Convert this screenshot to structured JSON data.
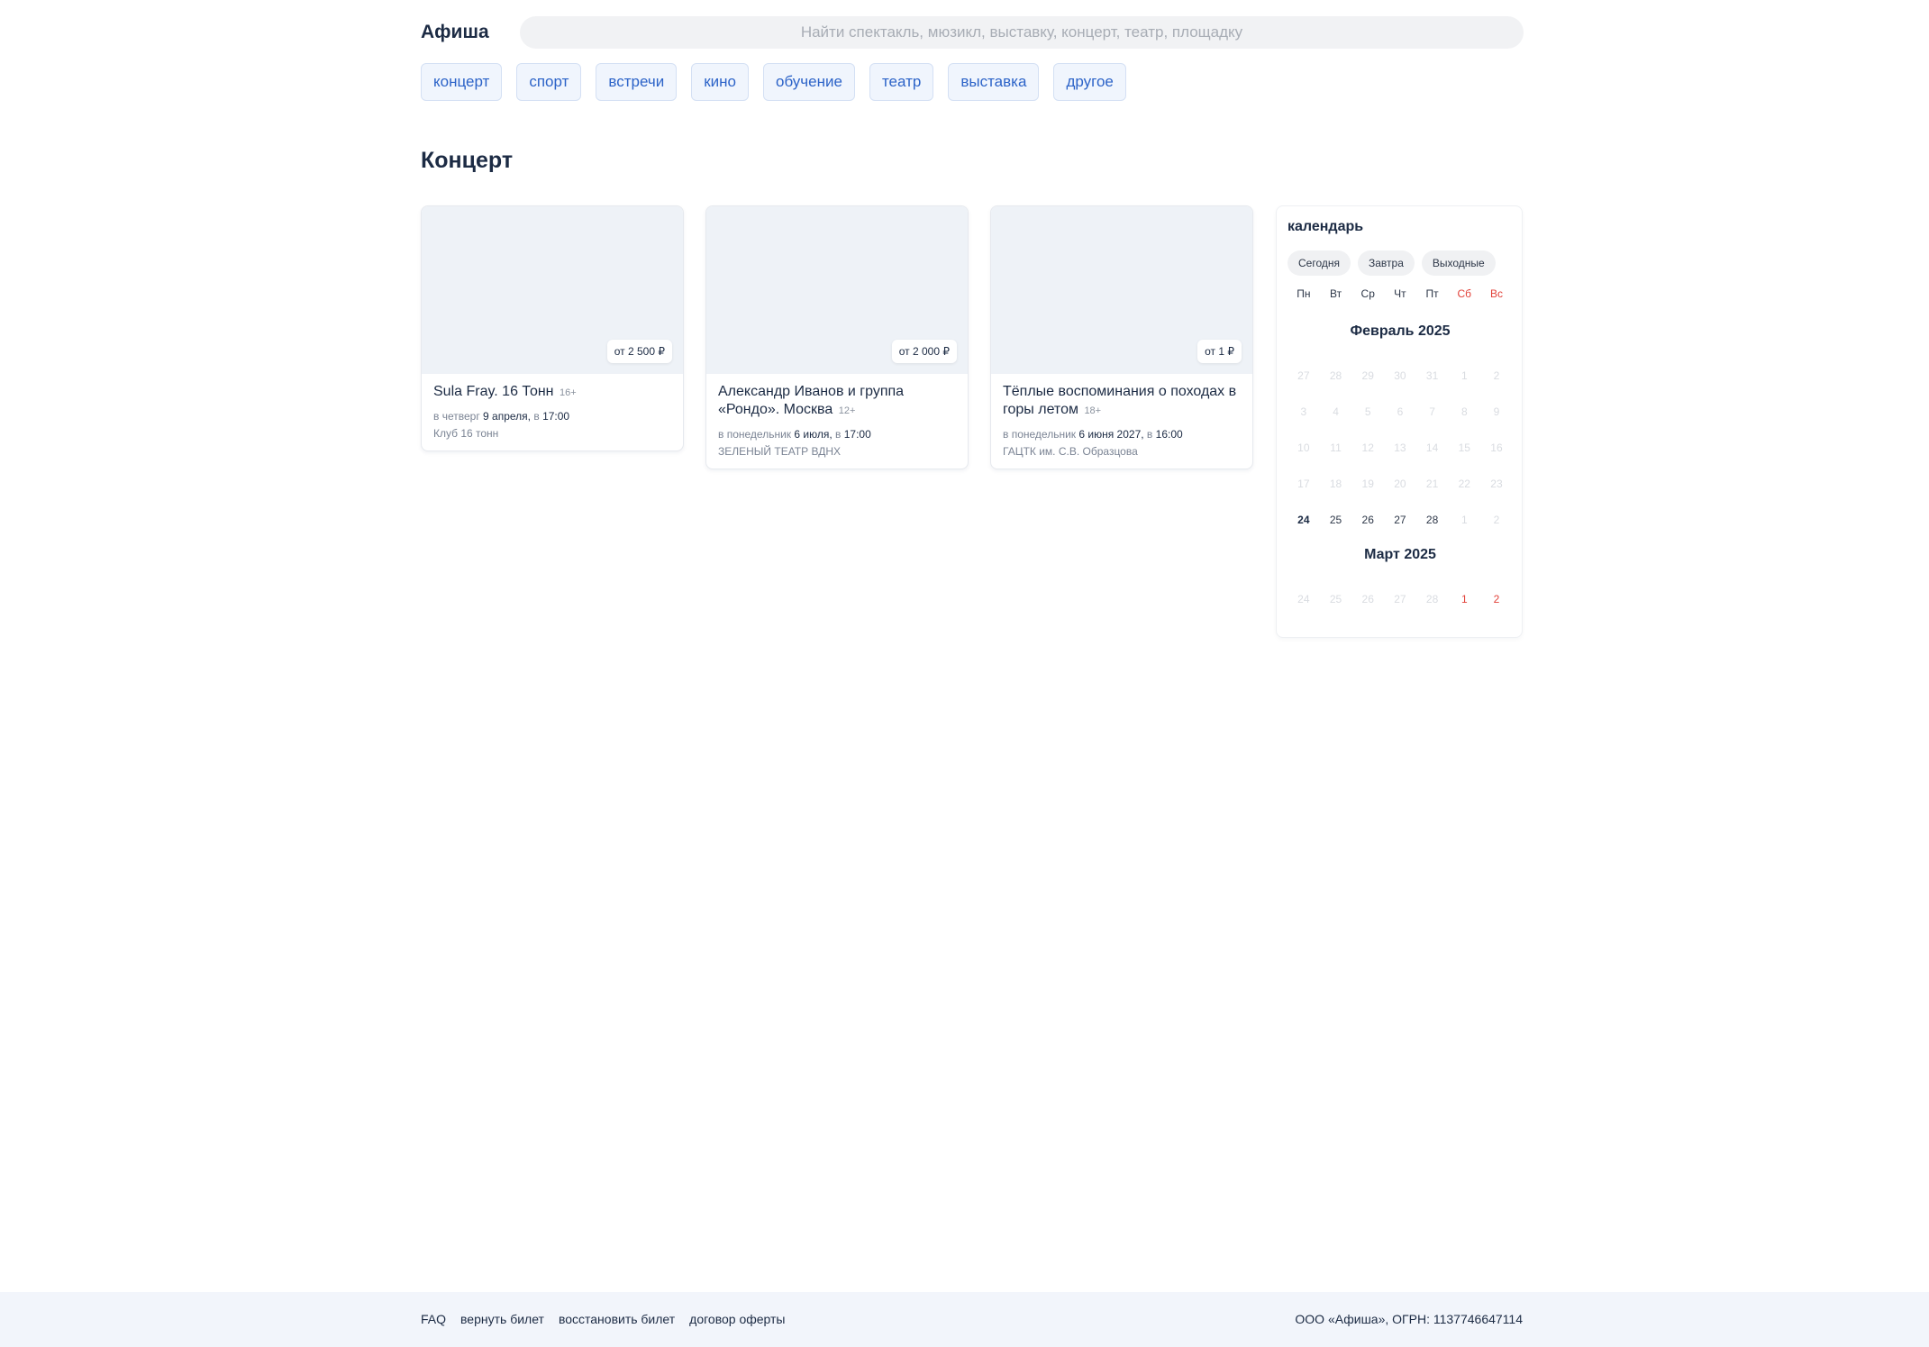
{
  "header": {
    "logo": "Афиша",
    "search_placeholder": "Найти спектакль, мюзикл, выставку, концерт, театр, площадку"
  },
  "categories": [
    "концерт",
    "спорт",
    "встречи",
    "кино",
    "обучение",
    "театр",
    "выставка",
    "другое"
  ],
  "section_title": "Концерт",
  "events": [
    {
      "title": "Sula Fray. 16 Тонн",
      "age": "16+",
      "price": "от 2 500 ₽",
      "when_prefix": "в четверг",
      "date": "9 апреля,",
      "time_prefix": "в",
      "time": "17:00",
      "place": "Клуб 16 тонн"
    },
    {
      "title": "Александр Иванов и группа «Рондо». Москва",
      "age": "12+",
      "price": "от 2 000 ₽",
      "when_prefix": "в понедельник",
      "date": "6 июля,",
      "time_prefix": "в",
      "time": "17:00",
      "place": "ЗЕЛЕНЫЙ ТЕАТР ВДНХ"
    },
    {
      "title": "Тёплые воспоминания о походах в горы летом",
      "age": "18+",
      "price": "от 1 ₽",
      "when_prefix": "в понедельник",
      "date": "6 июня 2027,",
      "time_prefix": "в",
      "time": "16:00",
      "place": "ГАЦТК им. С.В. Образцова"
    }
  ],
  "calendar": {
    "title": "календарь",
    "quick": [
      "Сегодня",
      "Завтра",
      "Выходные"
    ],
    "weekdays": [
      "Пн",
      "Вт",
      "Ср",
      "Чт",
      "Пт",
      "Сб",
      "Вс"
    ],
    "feb": {
      "name": "Февраль 2025",
      "rows": [
        [
          "27",
          "28",
          "29",
          "30",
          "31",
          "1",
          "2"
        ],
        [
          "3",
          "4",
          "5",
          "6",
          "7",
          "8",
          "9"
        ],
        [
          "10",
          "11",
          "12",
          "13",
          "14",
          "15",
          "16"
        ],
        [
          "17",
          "18",
          "19",
          "20",
          "21",
          "22",
          "23"
        ],
        [
          "24",
          "25",
          "26",
          "27",
          "28",
          "1",
          "2"
        ]
      ]
    },
    "mar": {
      "name": "Март 2025",
      "rows": [
        [
          "24",
          "25",
          "26",
          "27",
          "28",
          "1",
          "2"
        ]
      ]
    },
    "colors": {
      "weekend": "#e2423a",
      "accent": "#2c63c8"
    }
  },
  "footer": {
    "links": [
      "FAQ",
      "вернуть билет",
      "восстановить билет",
      "договор оферты"
    ],
    "copyright": "ООО «Афиша», ОГРН: 1137746647114"
  }
}
